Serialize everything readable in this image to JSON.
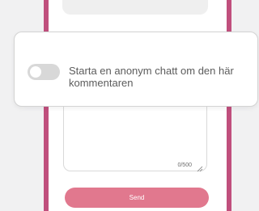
{
  "composer": {
    "char_counter": "0/500",
    "send_label": "Send"
  },
  "popup": {
    "anonymous_toggle_label": "Starta en anonym chatt om den här kommentaren",
    "toggle_on": false
  },
  "colors": {
    "frame_border": "#c04f7d",
    "send_button": "#e1788e",
    "toggle_off": "#d8d8d8"
  }
}
